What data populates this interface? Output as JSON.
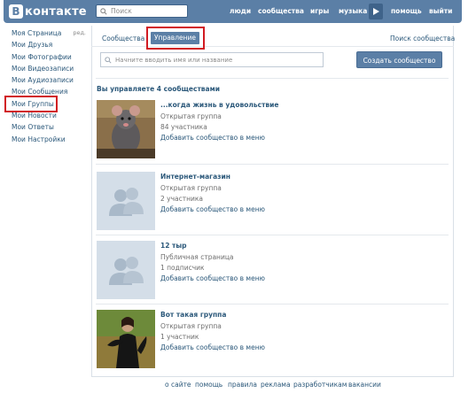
{
  "header": {
    "logo_letter": "В",
    "logo_text": "контакте",
    "search_placeholder": "Поиск",
    "nav": [
      "люди",
      "сообщества",
      "игры",
      "музыка",
      "помощь",
      "выйти"
    ]
  },
  "sidebar": {
    "edit_label": "ред.",
    "items": [
      "Моя Страница",
      "Мои Друзья",
      "Мои Фотографии",
      "Мои Видеозаписи",
      "Мои Аудиозаписи",
      "Мои Сообщения",
      "Мои Группы",
      "Мои Новости",
      "Мои Ответы",
      "Мои Настройки"
    ]
  },
  "tabs": {
    "communities": "Сообщества",
    "management": "Управление",
    "search_communities": "Поиск сообщества"
  },
  "filter": {
    "placeholder": "Начните вводить имя или название"
  },
  "create_button": "Создать сообщество",
  "section_title": "Вы управляете 4 сообществами",
  "groups": [
    {
      "name": "...когда жизнь в удовольствие",
      "type": "Открытая группа",
      "count": "84 участника",
      "add": "Добавить сообщество в меню"
    },
    {
      "name": "Интернет-магазин",
      "type": "Открытая группа",
      "count": "2 участника",
      "add": "Добавить сообщество в меню"
    },
    {
      "name": "12 тыр",
      "type": "Публичная страница",
      "count": "1 подписчик",
      "add": "Добавить сообщество в меню"
    },
    {
      "name": "Вот такая группа",
      "type": "Открытая группа",
      "count": "1 участник",
      "add": "Добавить сообщество в меню"
    }
  ],
  "footer": [
    "о сайте",
    "помощь",
    "правила",
    "реклама",
    "разработчикам",
    "вакансии"
  ],
  "colors": {
    "brand": "#5b7fa6",
    "link": "#2b587a",
    "highlight": "#d11b22"
  }
}
